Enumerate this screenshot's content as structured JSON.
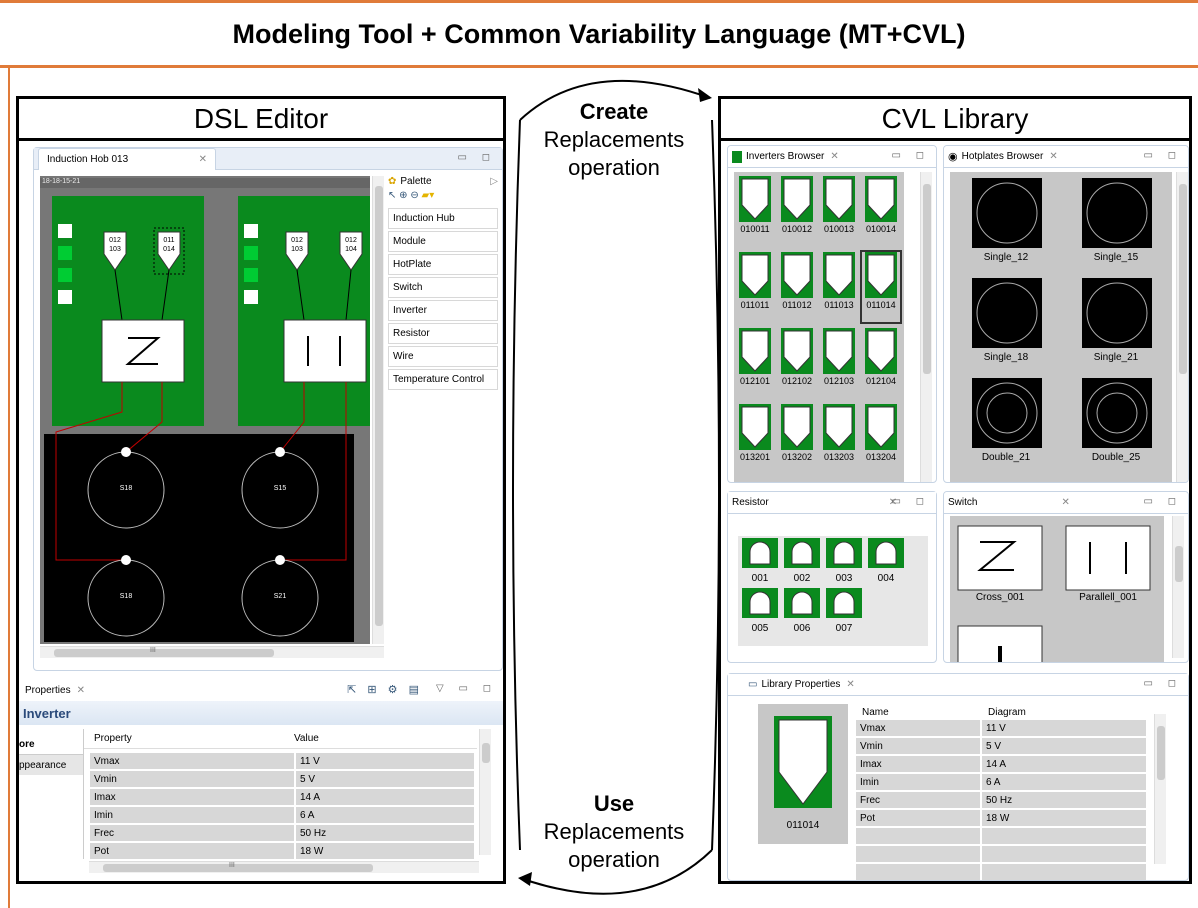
{
  "title": "Modeling Tool + Common Variability Language (MT+CVL)",
  "dsl_editor": {
    "heading": "DSL Editor",
    "editor_tab": "Induction Hob 013",
    "canvas_label": "18-18-15-21",
    "modules": [
      {
        "inverters": [
          "012\n103",
          "011\n014"
        ],
        "switch": "Z"
      },
      {
        "inverters": [
          "012\n103",
          "012\n104"
        ],
        "switch": "| |"
      }
    ],
    "hotplates": [
      "S18",
      "S15",
      "S18",
      "S21"
    ],
    "palette": {
      "title": "Palette",
      "items": [
        "Induction Hub",
        "Module",
        "HotPlate",
        "Switch",
        "Inverter",
        "Resistor",
        "Wire",
        "Temperature Control"
      ]
    },
    "properties": {
      "tab": "Properties",
      "heading": "Inverter",
      "side_tabs": [
        "ore",
        "ppearance"
      ],
      "col_property": "Property",
      "col_value": "Value",
      "rows": [
        {
          "k": "Vmax",
          "v": "11 V"
        },
        {
          "k": "Vmin",
          "v": "5 V"
        },
        {
          "k": "Imax",
          "v": "14 A"
        },
        {
          "k": "Imin",
          "v": "6 A"
        },
        {
          "k": "Frec",
          "v": "50 Hz"
        },
        {
          "k": "Pot",
          "v": "18 W"
        }
      ],
      "scroll_mark": "III"
    },
    "canvas_scroll_mark": "III"
  },
  "create_op": {
    "bold": "Create",
    "rest1": "Replacements",
    "rest2": "operation"
  },
  "use_op": {
    "bold": "Use",
    "rest1": "Replacements",
    "rest2": "operation"
  },
  "cvl_library": {
    "heading": "CVL Library",
    "inverters_browser": {
      "tab": "Inverters Browser",
      "items": [
        "010011",
        "010012",
        "010013",
        "010014",
        "011011",
        "011012",
        "011013",
        "011014",
        "012101",
        "012102",
        "012103",
        "012104",
        "013201",
        "013202",
        "013203",
        "013204"
      ],
      "selected": "011014"
    },
    "hotplates_browser": {
      "tab": "Hotplates Browser",
      "items": [
        "Single_12",
        "Single_15",
        "Single_18",
        "Single_21",
        "Double_21",
        "Double_25"
      ]
    },
    "resistor": {
      "tab": "Resistor",
      "items": [
        "001",
        "002",
        "003",
        "004",
        "005",
        "006",
        "007"
      ]
    },
    "switch": {
      "tab": "Switch",
      "items": [
        "Cross_001",
        "Parallell_001"
      ]
    },
    "library_properties": {
      "tab": "Library Properties",
      "preview_label": "011014",
      "col_name": "Name",
      "col_diagram": "Diagram",
      "rows": [
        {
          "k": "Vmax",
          "v": "11 V"
        },
        {
          "k": "Vmin",
          "v": "5 V"
        },
        {
          "k": "Imax",
          "v": "14 A"
        },
        {
          "k": "Imin",
          "v": "6 A"
        },
        {
          "k": "Frec",
          "v": "50 Hz"
        },
        {
          "k": "Pot",
          "v": "18 W"
        }
      ]
    }
  },
  "colors": {
    "accent": "#e07b39",
    "pcb_green": "#0a8a1e",
    "wire_red": "#c00000"
  },
  "icons": [
    "close-icon",
    "minimize-icon",
    "maximize-icon",
    "palette-icon",
    "pointer-icon",
    "zoom-in-icon",
    "zoom-out-icon"
  ]
}
